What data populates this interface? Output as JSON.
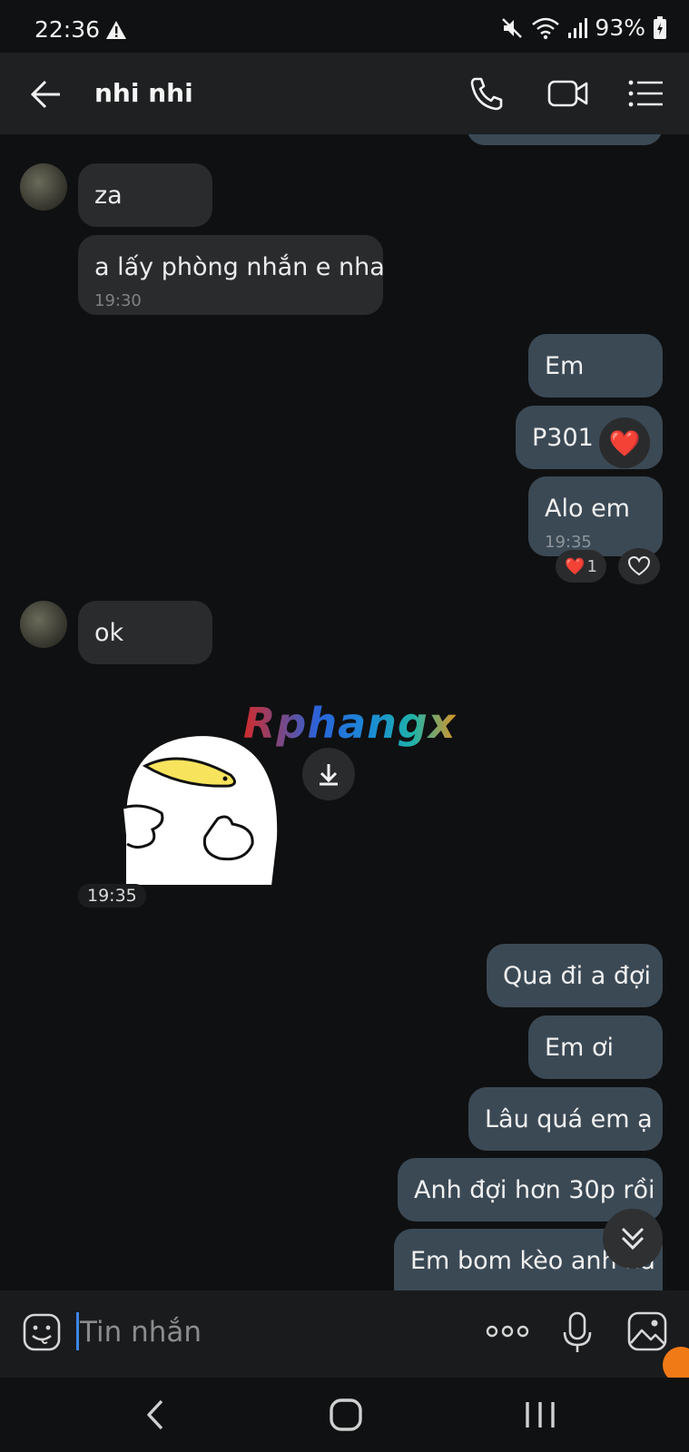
{
  "status_bar": {
    "time": "22:36",
    "battery": "93%"
  },
  "header": {
    "contact_name": "nhi nhi"
  },
  "messages": [
    {
      "dir": "in",
      "text": "za"
    },
    {
      "dir": "in",
      "text": "a lấy phòng nhắn e nha",
      "time": "19:30"
    },
    {
      "dir": "out",
      "text": "Em"
    },
    {
      "dir": "out",
      "text": "P301 nha",
      "reaction": "❤️"
    },
    {
      "dir": "out",
      "text": "Alo em",
      "time": "19:35",
      "reaction": "❤️",
      "reaction_count": "1"
    },
    {
      "dir": "in",
      "text": "ok"
    },
    {
      "dir": "in",
      "type": "sticker",
      "time": "19:35"
    },
    {
      "dir": "out",
      "text": "Qua đi a đợi"
    },
    {
      "dir": "out",
      "text": "Em ơi"
    },
    {
      "dir": "out",
      "text": "Lâu quá em ạ"
    },
    {
      "dir": "out",
      "text": "Anh đợi hơn 30p rồi"
    },
    {
      "dir": "out",
      "text": "Em bom kèo anh ha"
    }
  ],
  "watermark": "Rphangx",
  "input": {
    "placeholder": "Tin nhắn"
  },
  "colors": {
    "outgoing_bubble": "#3b4955",
    "incoming_bubble": "#2a2b2d",
    "background": "#0f1011",
    "accent": "#3d86e6"
  }
}
